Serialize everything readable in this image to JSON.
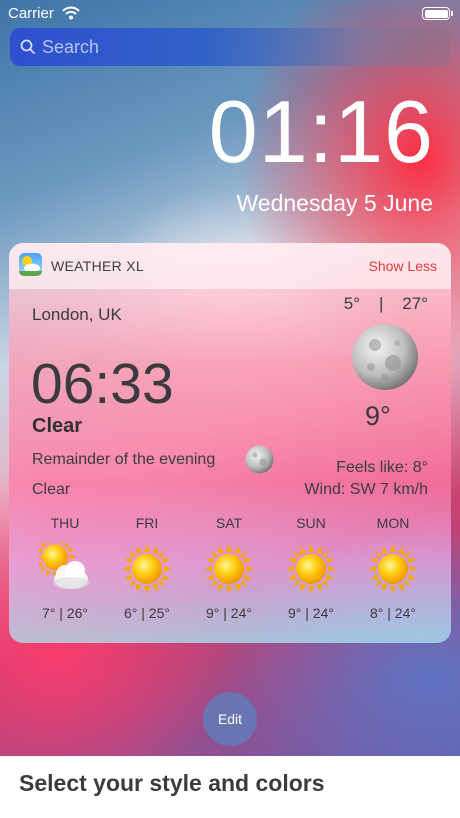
{
  "status_bar": {
    "carrier": "Carrier"
  },
  "search": {
    "placeholder": "Search"
  },
  "lock_screen": {
    "time": "01:16",
    "date": "Wednesday 5 June"
  },
  "widget": {
    "app_name": "WEATHER XL",
    "show_less": "Show Less",
    "location": "London, UK",
    "min_temp": "5°",
    "separator": "|",
    "max_temp": "27°",
    "local_time": "06:33",
    "condition": "Clear",
    "current_temp": "9°",
    "remainder": "Remainder of the evening",
    "remainder_condition": "Clear",
    "feels_like": "Feels like: 8°",
    "wind": "Wind: SW 7 km/h",
    "forecast": [
      {
        "day": "THU",
        "temps": "7° | 26°",
        "icon": "partly-cloudy-icon"
      },
      {
        "day": "FRI",
        "temps": "6° | 25°",
        "icon": "sun-icon"
      },
      {
        "day": "SAT",
        "temps": "9° | 24°",
        "icon": "sun-icon"
      },
      {
        "day": "SUN",
        "temps": "9° | 24°",
        "icon": "sun-icon"
      },
      {
        "day": "MON",
        "temps": "8° | 24°",
        "icon": "sun-icon"
      }
    ]
  },
  "edit_button": {
    "label": "Edit"
  },
  "caption": "Select your style and colors",
  "colors": {
    "accent_red": "#e33b3b",
    "search_blue": "#3163c7"
  }
}
